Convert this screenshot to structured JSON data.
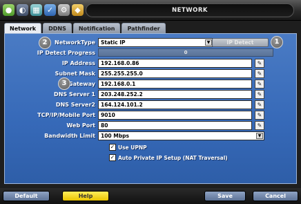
{
  "window": {
    "title": "NETWORK"
  },
  "toolbar_icons": [
    "camera-icon",
    "record-icon",
    "display-icon",
    "network-icon",
    "settings-icon",
    "shield-icon"
  ],
  "tabs": [
    {
      "label": "Network",
      "active": true
    },
    {
      "label": "DDNS",
      "active": false
    },
    {
      "label": "Notification",
      "active": false
    },
    {
      "label": "Pathfinder",
      "active": false
    }
  ],
  "form": {
    "network_type": {
      "label": "NetworkType",
      "value": "Static IP"
    },
    "ip_detect_button": "IP Detect",
    "ip_detect_progress": {
      "label": "IP Detect Progress",
      "value": "0"
    },
    "ip_address": {
      "label": "IP Address",
      "value": "192.168.0.86"
    },
    "subnet_mask": {
      "label": "Subnet Mask",
      "value": "255.255.255.0"
    },
    "gateway": {
      "label": "Gateway",
      "value": "192.168.0.1"
    },
    "dns1": {
      "label": "DNS Server 1",
      "value": "203.248.252.2"
    },
    "dns2": {
      "label": "DNS Server2",
      "value": "164.124.101.2"
    },
    "tcp_port": {
      "label": "TCP/IP/Mobile Port",
      "value": "9010"
    },
    "web_port": {
      "label": "Web Port",
      "value": "80"
    },
    "bandwidth": {
      "label": "Bandwidth Limit",
      "value": "100 Mbps"
    },
    "use_upnp": {
      "label": "Use UPNP",
      "checked": true
    },
    "auto_private_ip": {
      "label": "Auto Private IP Setup (NAT Traversal)",
      "checked": true
    }
  },
  "callouts": [
    "1",
    "2",
    "3"
  ],
  "buttons": {
    "default": "Default",
    "help": "Help",
    "save": "Save",
    "cancel": "Cancel"
  },
  "colors": {
    "panel": "#3a6cb8",
    "help_button": "#f2d61e",
    "title_bar": "#141414"
  }
}
